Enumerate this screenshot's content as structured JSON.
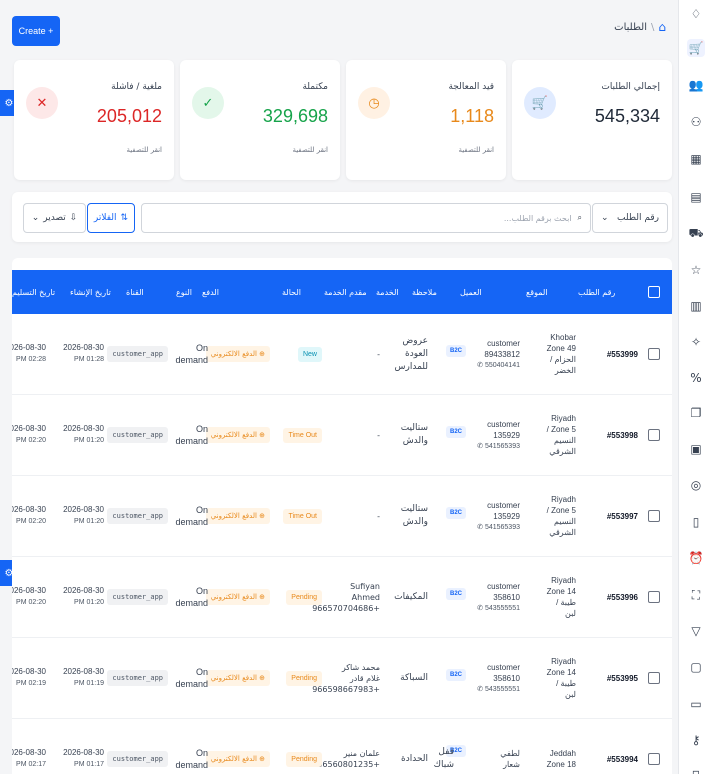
{
  "header": {
    "create_label": "Create +",
    "breadcrumb": "الطلبات",
    "breadcrumb_sep": "\\"
  },
  "stats": [
    {
      "label": "إجمالي الطلبات",
      "value": "545,334",
      "hint": "",
      "color": "#1f2937",
      "icon": "cart-icon"
    },
    {
      "label": "قيد المعالجة",
      "value": "1,118",
      "hint": "انقر للتصفية",
      "color": "#e8891b",
      "icon": "clock-icon"
    },
    {
      "label": "مكتملة",
      "value": "329,698",
      "hint": "انقر للتصفية",
      "color": "#16a34a",
      "icon": "check-icon"
    },
    {
      "label": "ملغية / فاشلة",
      "value": "205,012",
      "hint": "انقر للتصفية",
      "color": "#dc2626",
      "icon": "x-icon"
    }
  ],
  "filters": {
    "select_value": "رقم الطلب",
    "search_placeholder": "ابحث برقم الطلب...",
    "filters_label": "الفلاتر",
    "export_label": "تصدير"
  },
  "table": {
    "columns": [
      "رقم الطلب",
      "الموقع",
      "العميل",
      "ملاحظة",
      "الخدمة",
      "مقدم الخدمة",
      "الحالة",
      "الدفع",
      "النوع",
      "القناة",
      "تاريخ الإنشاء",
      "تاريخ التسليم"
    ],
    "rows": [
      {
        "id": "#553999",
        "loc": [
          "Khobar",
          "Zone 49",
          "/ الحزام",
          "الخضر"
        ],
        "cust_name": "customer",
        "cust_num": "89433812",
        "cust_phone": "550404141",
        "note": "",
        "service": [
          "عروض",
          "العودة",
          "للمدارس"
        ],
        "provider": [
          "-"
        ],
        "status": "New",
        "status_kind": "new",
        "payment": "الدفع الالكتروني",
        "type": [
          "On",
          "demand"
        ],
        "channel": "customer_app",
        "created": "2026-08-30",
        "created_time": "PM 01:28",
        "delivered": "2026-08-30",
        "delivered_time": "PM 02:28"
      },
      {
        "id": "#553998",
        "loc": [
          "Riyadh",
          "/ Zone 5",
          "النسيم",
          "الشرقي"
        ],
        "cust_name": "customer",
        "cust_num": "135929",
        "cust_phone": "541565393",
        "note": "",
        "service": [
          "ستاليت",
          "والدش"
        ],
        "provider": [
          "-"
        ],
        "status": "Time Out",
        "status_kind": "warn",
        "payment": "الدفع الالكتروني",
        "type": [
          "On",
          "demand"
        ],
        "channel": "customer_app",
        "created": "2026-08-30",
        "created_time": "PM 01:20",
        "delivered": "2026-08-30",
        "delivered_time": "PM 02:20"
      },
      {
        "id": "#553997",
        "loc": [
          "Riyadh",
          "/ Zone 5",
          "النسيم",
          "الشرقي"
        ],
        "cust_name": "customer",
        "cust_num": "135929",
        "cust_phone": "541565393",
        "note": "",
        "service": [
          "ستاليت",
          "والدش"
        ],
        "provider": [
          "-"
        ],
        "status": "Time Out",
        "status_kind": "warn",
        "payment": "الدفع الالكتروني",
        "type": [
          "On",
          "demand"
        ],
        "channel": "customer_app",
        "created": "2026-08-30",
        "created_time": "PM 01:20",
        "delivered": "2026-08-30",
        "delivered_time": "PM 02:20"
      },
      {
        "id": "#553996",
        "loc": [
          "Riyadh",
          "Zone 14",
          "/ طيبة",
          "لبن"
        ],
        "cust_name": "customer",
        "cust_num": "358610",
        "cust_phone": "543555551",
        "note": "",
        "service": [
          "المكيفات"
        ],
        "provider": [
          "Sufiyan",
          "Ahmed",
          "966570704686+"
        ],
        "status": "Pending",
        "status_kind": "warn",
        "payment": "الدفع الالكتروني",
        "type": [
          "On",
          "demand"
        ],
        "channel": "customer_app",
        "created": "2026-08-30",
        "created_time": "PM 01:20",
        "delivered": "2026-08-30",
        "delivered_time": "PM 02:20"
      },
      {
        "id": "#553995",
        "loc": [
          "Riyadh",
          "Zone 14",
          "/ طيبة",
          "لبن"
        ],
        "cust_name": "customer",
        "cust_num": "358610",
        "cust_phone": "543555551",
        "note": "",
        "service": [
          "السباكة"
        ],
        "provider": [
          "محمد شاكر",
          "غلام قادر",
          "966598667983+"
        ],
        "status": "Pending",
        "status_kind": "warn",
        "payment": "الدفع الالكتروني",
        "type": [
          "On",
          "demand"
        ],
        "channel": "customer_app",
        "created": "2026-08-30",
        "created_time": "PM 01:19",
        "delivered": "2026-08-30",
        "delivered_time": "PM 02:19"
      },
      {
        "id": "#553994",
        "loc": [
          "Jeddah",
          "Zone 18",
          ""
        ],
        "cust_name": "لطفي",
        "cust_num": "شعار",
        "cust_phone": "",
        "note": [
          "قفل",
          "شباك"
        ],
        "service": [
          "الحدادة"
        ],
        "provider": [
          "علمان منير",
          "966560801235+"
        ],
        "status": "Pending",
        "status_kind": "warn",
        "payment": "الدفع الالكتروني",
        "type": [
          "On",
          "demand"
        ],
        "channel": "customer_app",
        "created": "2026-08-30",
        "created_time": "PM 01:17",
        "delivered": "2026-08-30",
        "delivered_time": "PM 02:17"
      }
    ]
  }
}
